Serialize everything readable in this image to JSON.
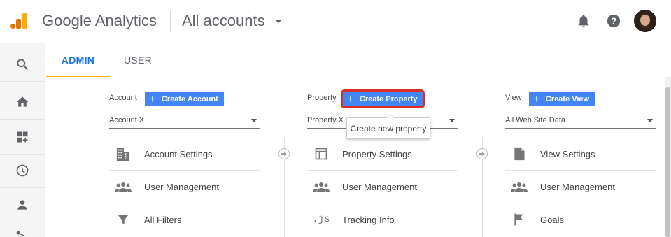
{
  "header": {
    "app_title": "Google Analytics",
    "account_selector": "All accounts",
    "icons": [
      "ga-logo-icon",
      "bell-icon",
      "help-icon",
      "avatar"
    ]
  },
  "rail": {
    "icons": [
      "search-icon",
      "home-icon",
      "customization-icon",
      "clock-icon",
      "person-icon",
      "share-icon"
    ]
  },
  "tabs": [
    {
      "label": "ADMIN",
      "active": true
    },
    {
      "label": "USER",
      "active": false
    }
  ],
  "colors": {
    "accent_blue": "#4285f4",
    "tab_underline": "#f4b400",
    "highlight_red": "#d93025"
  },
  "account": {
    "label": "Account",
    "create_label": "Create Account",
    "selected": "Account X",
    "items": [
      {
        "label": "Account Settings",
        "icon": "building-icon"
      },
      {
        "label": "User Management",
        "icon": "people-icon"
      },
      {
        "label": "All Filters",
        "icon": "filter-icon"
      }
    ]
  },
  "property": {
    "label": "Property",
    "create_label": "Create Property",
    "selected": "Property X",
    "tooltip": "Create new property",
    "items": [
      {
        "label": "Property Settings",
        "icon": "layout-icon"
      },
      {
        "label": "User Management",
        "icon": "people-icon"
      },
      {
        "label": "Tracking Info",
        "icon": "js-icon",
        "icon_text": ".js"
      }
    ]
  },
  "view": {
    "label": "View",
    "create_label": "Create View",
    "selected": "All Web Site Data",
    "items": [
      {
        "label": "View Settings",
        "icon": "document-icon"
      },
      {
        "label": "User Management",
        "icon": "people-icon"
      },
      {
        "label": "Goals",
        "icon": "flag-icon"
      }
    ]
  }
}
